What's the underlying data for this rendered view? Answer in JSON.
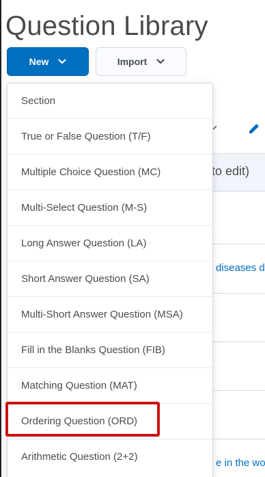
{
  "page": {
    "title": "Question Library"
  },
  "toolbar": {
    "new_label": "New",
    "import_label": "Import"
  },
  "background": {
    "header_fragment": "to edit)",
    "link_1": "diseases d",
    "link_2": "e in the wo"
  },
  "menu": {
    "items": [
      {
        "label": "Section"
      },
      {
        "label": "True or False Question (T/F)"
      },
      {
        "label": "Multiple Choice Question (MC)"
      },
      {
        "label": "Multi-Select Question (M-S)"
      },
      {
        "label": "Long Answer Question (LA)"
      },
      {
        "label": "Short Answer Question (SA)"
      },
      {
        "label": "Multi-Short Answer Question (MSA)"
      },
      {
        "label": "Fill in the Blanks Question (FIB)"
      },
      {
        "label": "Matching Question (MAT)"
      },
      {
        "label": "Ordering Question (ORD)"
      },
      {
        "label": "Arithmetic Question (2+2)"
      }
    ],
    "highlighted_item": "Ordering Question (ORD)"
  },
  "colors": {
    "primary": "#006fbf",
    "highlight": "#cc1111",
    "text": "#494c4e"
  },
  "icons": {
    "new_dropdown": "chevron-down-icon",
    "import_dropdown": "chevron-down-icon",
    "edit": "pencil-icon"
  }
}
